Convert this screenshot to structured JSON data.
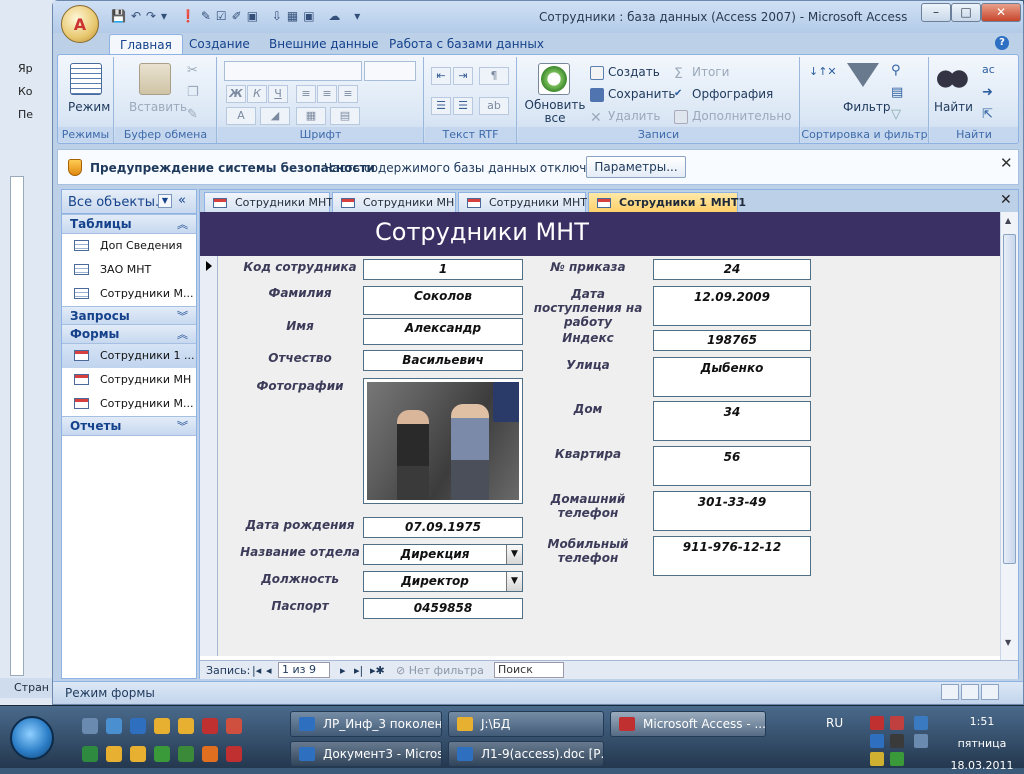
{
  "background_window": {
    "items": [
      "Яр",
      "Ко",
      "Пе"
    ],
    "status": "Стран"
  },
  "window": {
    "title": "Сотрудники : база данных (Access 2007) - Microsoft Access",
    "office_button": "A"
  },
  "ribbon": {
    "tabs": [
      "Главная",
      "Создание",
      "Внешние данные",
      "Работа с базами данных"
    ],
    "groups": {
      "modes": {
        "label": "Режимы",
        "view": "Режим"
      },
      "clipboard": {
        "label": "Буфер обмена",
        "paste": "Вставить"
      },
      "font": {
        "label": "Шрифт",
        "bold": "Ж",
        "italic": "К",
        "underline": "Ч",
        "font_color": "A"
      },
      "rtf": {
        "label": "Текст RTF"
      },
      "records": {
        "label": "Записи",
        "refresh": "Обновить все",
        "new": "Создать",
        "save": "Сохранить",
        "delete": "Удалить",
        "totals": "Итоги",
        "spelling": "Орфография",
        "more": "Дополнительно"
      },
      "sort": {
        "label": "Сортировка и фильтр",
        "filter": "Фильтр"
      },
      "find": {
        "label": "Найти",
        "find": "Найти"
      }
    },
    "help": "?"
  },
  "security_bar": {
    "title": "Предупреждение системы безопасности",
    "text": "Часть содержимого базы данных отключено",
    "button": "Параметры...",
    "close": "✕"
  },
  "nav_pane": {
    "title": "Все объекты...",
    "groups": [
      {
        "name": "Таблицы",
        "items": [
          "Доп Сведения",
          "ЗАО МНТ",
          "Сотрудники М..."
        ]
      },
      {
        "name": "Запросы",
        "items": []
      },
      {
        "name": "Формы",
        "items": [
          "Сотрудники 1 ...",
          "Сотрудники МН",
          "Сотрудники М..."
        ]
      },
      {
        "name": "Отчеты",
        "items": []
      }
    ]
  },
  "doc_tabs": [
    "Сотрудники МНТ",
    "Сотрудники МН",
    "Сотрудники МНТ",
    "Сотрудники 1 МНТ1"
  ],
  "form": {
    "title": "Сотрудники МНТ",
    "left_fields": [
      {
        "label": "Код сотрудника",
        "value": "1"
      },
      {
        "label": "Фамилия",
        "value": "Соколов"
      },
      {
        "label": "Имя",
        "value": "Александр"
      },
      {
        "label": "Отчество",
        "value": "Васильевич"
      },
      {
        "label": "Фотографии",
        "value": ""
      },
      {
        "label": "Дата рождения",
        "value": "07.09.1975"
      },
      {
        "label": "Название отдела",
        "value": "Дирекция"
      },
      {
        "label": "Должность",
        "value": "Директор"
      },
      {
        "label": "Паспорт",
        "value": "0459858"
      }
    ],
    "right_fields": [
      {
        "label": "№ приказа",
        "value": "24"
      },
      {
        "label": "Дата поступления на работу",
        "value": "12.09.2009"
      },
      {
        "label": "Индекс",
        "value": "198765"
      },
      {
        "label": "Улица",
        "value": "Дыбенко"
      },
      {
        "label": "Дом",
        "value": "34"
      },
      {
        "label": "Квартира",
        "value": "56"
      },
      {
        "label": "Домашний телефон",
        "value": "301-33-49"
      },
      {
        "label": "Мобильный телефон",
        "value": "911-976-12-12"
      }
    ]
  },
  "record_nav": {
    "label": "Запись:",
    "position": "1 из 9",
    "filter": "Нет фильтра",
    "search": "Поиск"
  },
  "status_bar": {
    "text": "Режим формы"
  },
  "taskbar": {
    "buttons": [
      "ЛР_Инф_3 поколен...",
      "J:\\БД",
      "Microsoft Access - ...",
      "Документ3 - Micros...",
      "Л1-9(access).doc [Р..."
    ],
    "lang": "RU",
    "time": "1:51",
    "day": "пятница",
    "date": "18.03.2011"
  }
}
